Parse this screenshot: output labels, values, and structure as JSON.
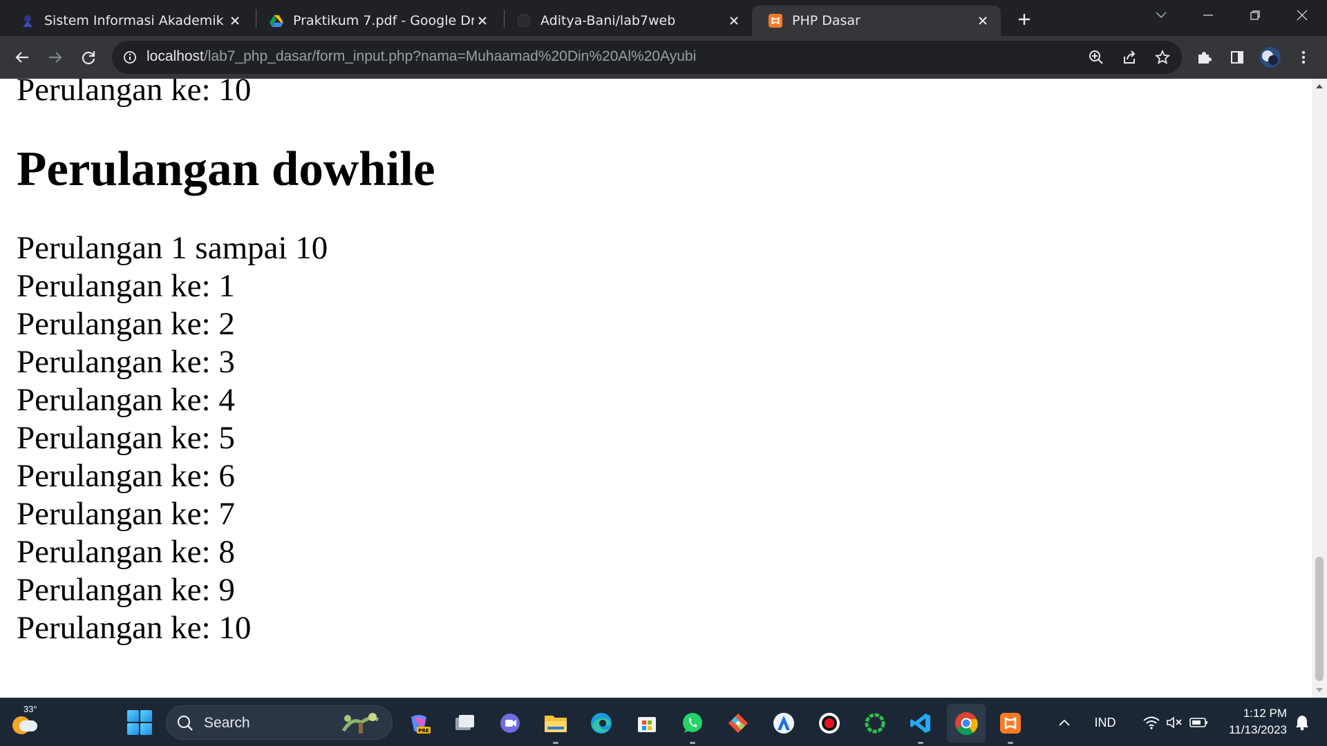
{
  "tabs": [
    {
      "title": "Sistem Informasi Akademik",
      "icon": "university-favicon-icon"
    },
    {
      "title": "Praktikum 7.pdf - Google Drive",
      "icon": "google-drive-icon"
    },
    {
      "title": "Aditya-Bani/lab7web",
      "icon": "github-icon"
    },
    {
      "title": "PHP Dasar",
      "icon": "xampp-icon",
      "active": true
    }
  ],
  "address_bar": {
    "host": "localhost",
    "path": "/lab7_php_dasar/form_input.php?nama=Muhaamad%20Din%20Al%20Ayubi"
  },
  "page": {
    "partial_top_line": "Perulangan ke: 10",
    "heading": "Perulangan dowhile",
    "intro": "Perulangan 1 sampai 10",
    "lines": [
      "Perulangan ke: 1",
      "Perulangan ke: 2",
      "Perulangan ke: 3",
      "Perulangan ke: 4",
      "Perulangan ke: 5",
      "Perulangan ke: 6",
      "Perulangan ke: 7",
      "Perulangan ke: 8",
      "Perulangan ke: 9",
      "Perulangan ke: 10"
    ]
  },
  "taskbar": {
    "weather_temp": "33°",
    "search_label": "Search",
    "language": "IND",
    "time": "1:12 PM",
    "date": "11/13/2023",
    "apps": [
      "copilot-pre-icon",
      "task-view-icon",
      "teams-chat-icon",
      "file-explorer-icon",
      "edge-icon",
      "microsoft-store-icon",
      "whatsapp-icon",
      "git-icon",
      "vpn-icon",
      "screen-recorder-icon",
      "app-ring-icon",
      "vscode-icon",
      "chrome-icon",
      "xampp-icon"
    ]
  },
  "colors": {
    "tab_strip": "#202124",
    "toolbar": "#35363a",
    "page_bg": "#ffffff",
    "taskbar": "#1b2735",
    "xampp_orange": "#fb7a24"
  }
}
